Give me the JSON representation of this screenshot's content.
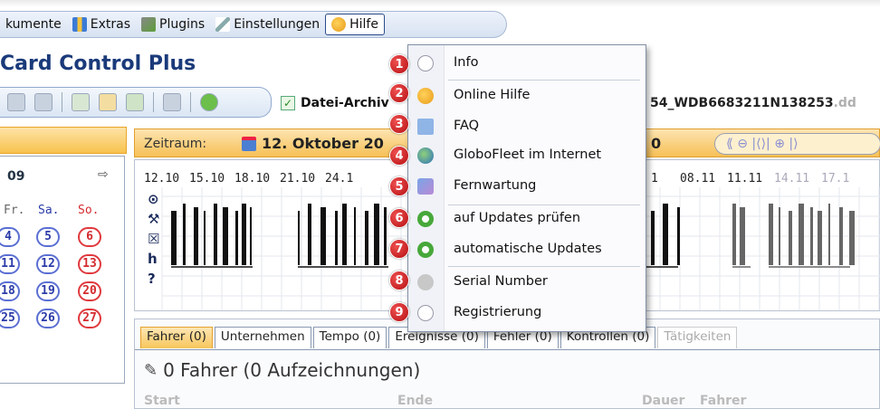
{
  "menubar": {
    "items": [
      {
        "label": "kumente",
        "icon": "document-icon"
      },
      {
        "label": "Extras",
        "icon": "table-icon"
      },
      {
        "label": "Plugins",
        "icon": "puzzle-icon"
      },
      {
        "label": "Einstellungen",
        "icon": "wrench-icon"
      },
      {
        "label": "Hilfe",
        "icon": "help-chat-icon"
      }
    ]
  },
  "app": {
    "title": "Card Control Plus"
  },
  "toolbar": {
    "archive_label": "Datei-Archiv",
    "filename": "54_WDB6683211N138253",
    "filename_ext": ".dd"
  },
  "calendar": {
    "year": "09",
    "days_header": [
      "Fr.",
      "Sa.",
      "So."
    ],
    "weeks": [
      [
        "4",
        "5",
        "6"
      ],
      [
        "11",
        "12",
        "13"
      ],
      [
        "18",
        "19",
        "20"
      ],
      [
        "25",
        "26",
        "27"
      ]
    ]
  },
  "timeline": {
    "range_label": "Zeitraum:",
    "start_date": "12. Oktober 20",
    "end_date": "0",
    "ticks_left": [
      "12.10",
      "15.10",
      "18.10",
      "21.10",
      "24.1"
    ],
    "ticks_right": [
      "1",
      "08.11",
      "11.11",
      "14.11",
      "17.1"
    ],
    "activity_symbols": [
      "⊙",
      "⚒",
      "☒",
      "h",
      "?"
    ]
  },
  "tabs": {
    "items": [
      {
        "label": "Fahrer (0)",
        "active": true
      },
      {
        "label": "Unternehmen",
        "active": false
      },
      {
        "label": "Tempo (0)",
        "active": false
      },
      {
        "label": "Ereignisse (0)",
        "active": false
      },
      {
        "label": "Fehler (0)",
        "active": false
      },
      {
        "label": "Kontrollen (0)",
        "active": false
      },
      {
        "label": "Tätigkeiten",
        "active": false
      }
    ],
    "driver_summary": "0 Fahrer (0 Aufzeichnungen)",
    "columns": [
      "Start",
      "Ende",
      "Dauer",
      "Fahrer"
    ]
  },
  "help_menu": {
    "items": [
      {
        "num": "1",
        "label": "Info",
        "icon": "info-icon"
      },
      {
        "num": "2",
        "label": "Online Hilfe",
        "icon": "help-chat-icon"
      },
      {
        "num": "3",
        "label": "FAQ",
        "icon": "book-icon"
      },
      {
        "num": "4",
        "label": "GloboFleet im Internet",
        "icon": "globe-icon"
      },
      {
        "num": "5",
        "label": "Fernwartung",
        "icon": "remote-icon"
      },
      {
        "num": "6",
        "label": "auf Updates prüfen",
        "icon": "refresh-icon"
      },
      {
        "num": "7",
        "label": "automatische Updates",
        "icon": "refresh-icon"
      },
      {
        "num": "8",
        "label": "Serial Number",
        "icon": "serial-icon"
      },
      {
        "num": "9",
        "label": "Registrierung",
        "icon": "register-icon"
      }
    ]
  },
  "colors": {
    "accent_orange": "#f8c24e",
    "badge_red": "#c81417",
    "menu_blue": "#2b4c8c"
  }
}
